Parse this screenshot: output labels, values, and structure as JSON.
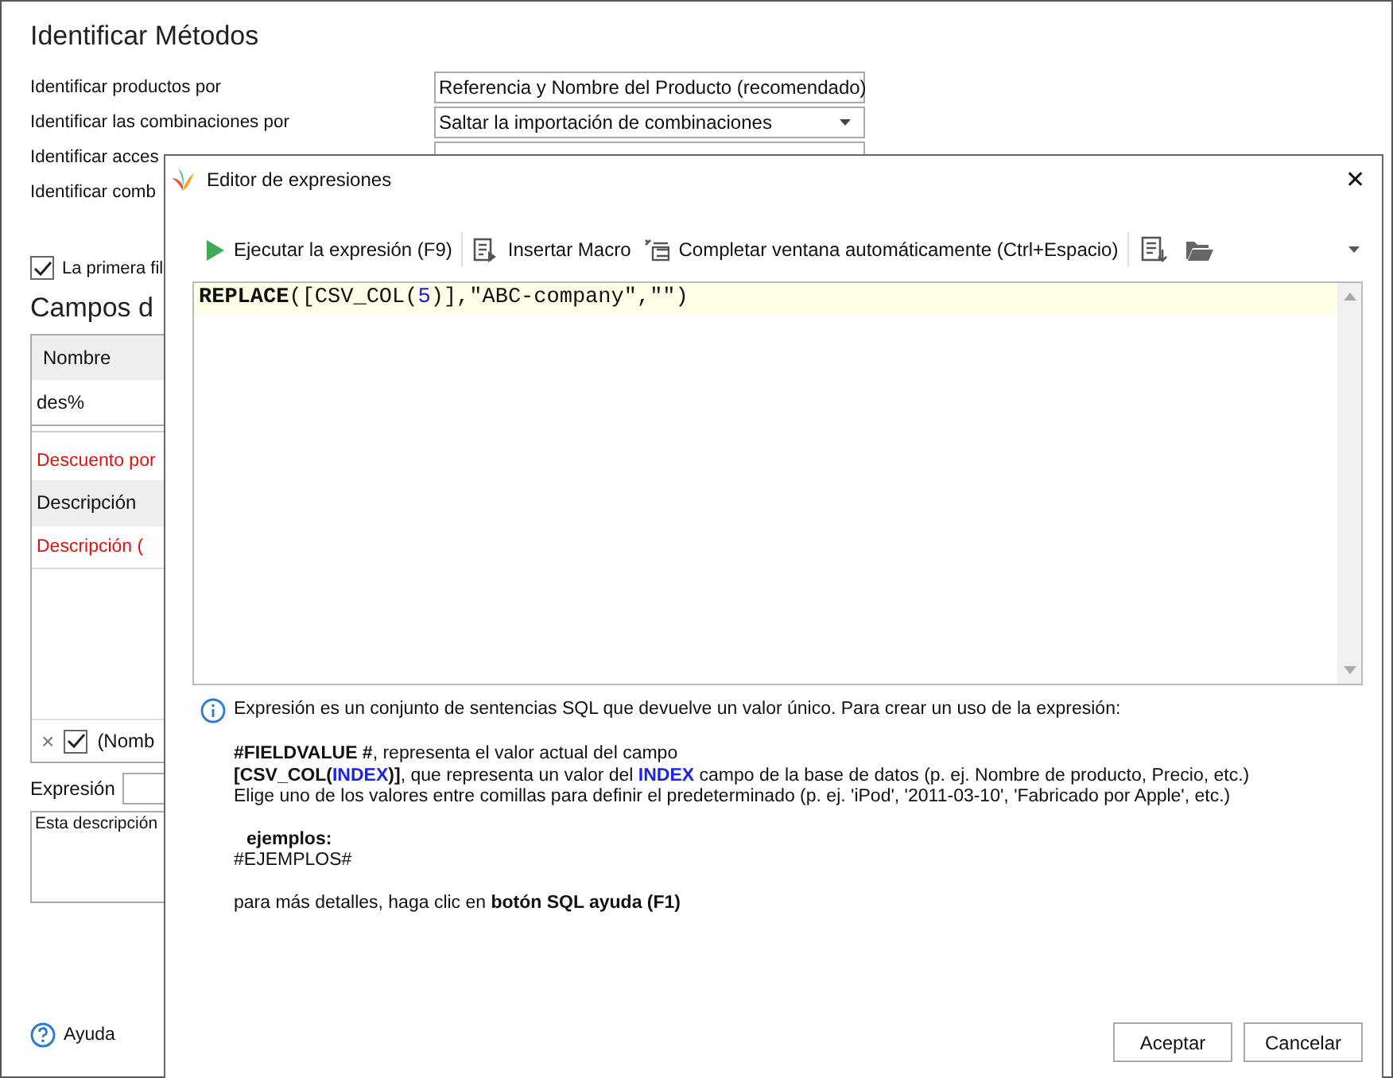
{
  "window": {
    "title": "Identificar Métodos"
  },
  "settings": [
    {
      "label": "Identificar productos por",
      "kind": "dropdown",
      "value": "Referencia y Nombre del Producto (recomendado)"
    },
    {
      "label": "Identificar las combinaciones por",
      "kind": "dropdown",
      "value": "Saltar la importación de combinaciones"
    },
    {
      "label": "Identificar acces",
      "kind": "dropdown"
    },
    {
      "label": "Identificar comb",
      "kind": "label"
    }
  ],
  "header_checkbox": {
    "label": "La primera fil",
    "checked": true
  },
  "section_title": "Campos d",
  "fields_table": {
    "column": "Nombre",
    "row": "des%"
  },
  "discount_label": "Descuento por",
  "description_table": {
    "column": "Descripción",
    "row": "Descripción ("
  },
  "footer_row": {
    "close": "×",
    "checked": true,
    "label": "(Nomb"
  },
  "expression": {
    "label": "Expresión"
  },
  "description": "Esta descripción",
  "help": "Ayuda",
  "dialog": {
    "title": "Editor de expresiones",
    "close": "✕",
    "toolbar": [
      {
        "kind": "run",
        "label": "Ejecutar la expresión (F9)"
      },
      {
        "kind": "macro",
        "label": "Insertar Macro"
      },
      {
        "kind": "autocomplete",
        "label": "Completar ventana automáticamente (Ctrl+Espacio)"
      },
      {
        "kind": "save"
      },
      {
        "kind": "open"
      }
    ],
    "code": "**REPLACE**([CSV_COL(*5*)],\"ABC-company\",\"\")",
    "info": [
      "Expresión es un conjunto de sentencias SQL que devuelve un valor único. Para crear un uso de la expresión:",
      "**#FIELDVALUE #**, representa el valor actual del campo",
      "**[CSV_COL(*INDEX*)]**, que representa un valor del *INDEX* campo de la base de datos (p. ej. Nombre de producto, Precio, etc.)",
      "Elige uno de los valores entre comillas para definir el predeterminado (p. ej. 'iPod', '2011-03-10', 'Fabricado por Apple', etc.)",
      "ejemplos:",
      "#EJEMPLOS#",
      "para más detalles, haga clic en **botón SQL ayuda (F1)**"
    ],
    "buttons": [
      "Aceptar",
      "Cancelar"
    ]
  }
}
